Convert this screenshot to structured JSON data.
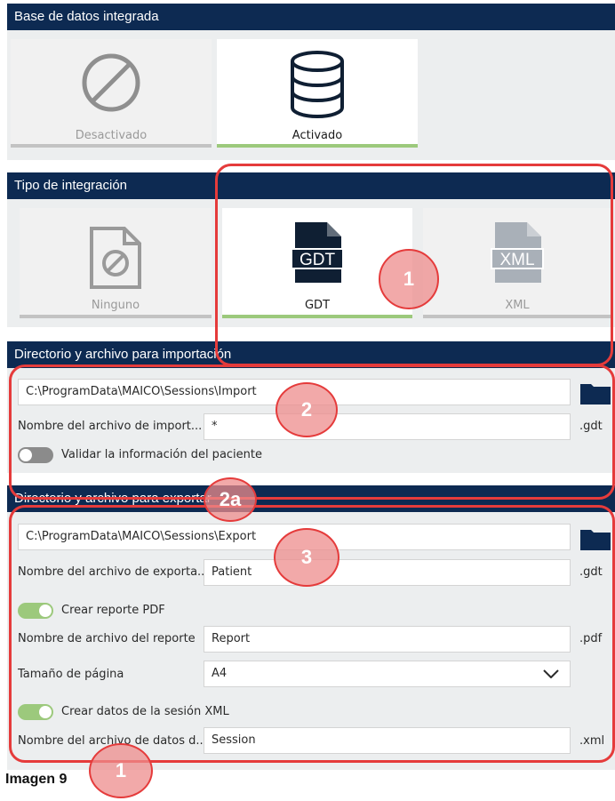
{
  "sections": {
    "database": {
      "header": "Base de datos integrada",
      "options": [
        {
          "label": "Desactivado",
          "icon": "disabled-circle-icon",
          "selected": false
        },
        {
          "label": "Activado",
          "icon": "database-icon",
          "selected": true
        }
      ]
    },
    "integration_type": {
      "header": "Tipo de integración",
      "options": [
        {
          "label": "Ninguno",
          "icon": "none-file-icon",
          "selected": false
        },
        {
          "label": "GDT",
          "icon": "gdt-file-icon",
          "icon_text": "GDT",
          "selected": true
        },
        {
          "label": "XML",
          "icon": "xml-file-icon",
          "icon_text": "XML",
          "selected": false
        }
      ]
    },
    "import": {
      "header": "Directorio y archivo para importación",
      "path": "C:\\ProgramData\\MAICO\\Sessions\\Import",
      "filename_label": "Nombre del archivo de import...",
      "filename_value": "*",
      "filename_ext": ".gdt",
      "validate_label": "Validar la información del paciente",
      "validate_on": false
    },
    "export": {
      "header": "Directorio y archivo para exportar",
      "path": "C:\\ProgramData\\MAICO\\Sessions\\Export",
      "filename_label": "Nombre del archivo de exporta...",
      "filename_value": "Patient",
      "filename_ext": ".gdt",
      "pdf_toggle_label": "Crear reporte PDF",
      "pdf_toggle_on": true,
      "report_label": "Nombre de archivo del reporte",
      "report_value": "Report",
      "report_ext": ".pdf",
      "page_size_label": "Tamaño de página",
      "page_size_value": "A4",
      "xml_toggle_label": "Crear datos de la sesión XML",
      "xml_toggle_on": true,
      "session_label": "Nombre del archivo de datos d...",
      "session_value": "Session",
      "session_ext": ".xml"
    }
  },
  "callouts": [
    "1",
    "2",
    "2a",
    "3",
    "1"
  ],
  "caption": "Imagen 9",
  "colors": {
    "header_bg": "#0d2a52",
    "accent_green": "#9cc97c",
    "callout_red": "#e53b3b",
    "panel_bg": "#eceeef"
  }
}
